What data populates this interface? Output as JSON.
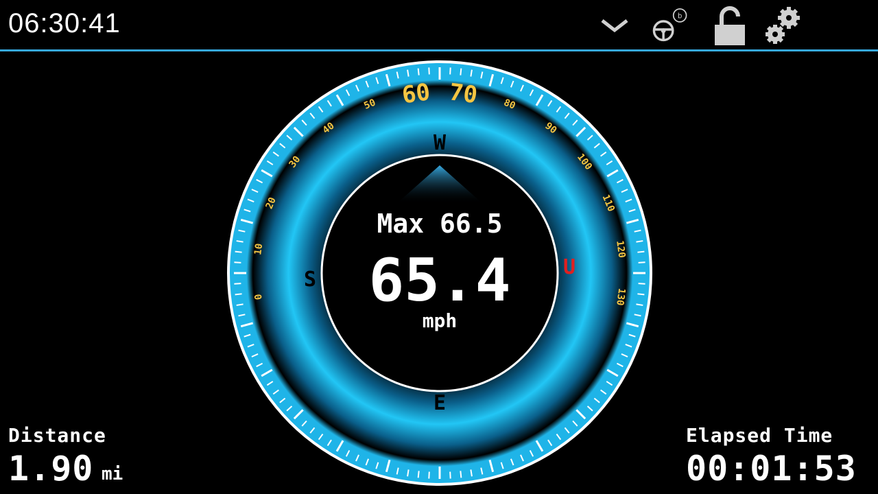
{
  "status_bar": {
    "time": "06:30:41"
  },
  "toolbar": {
    "icons": [
      "chevron-down-icon",
      "steering-wheel-icon",
      "lock-icon",
      "settings-gears-icon"
    ]
  },
  "gauge": {
    "max_label": "Max 66.5",
    "current_speed": "65.4",
    "speed_unit": "mph",
    "highlight_labels": [
      "60",
      "70"
    ],
    "scale_labels": [
      "0",
      "10",
      "20",
      "30",
      "40",
      "50",
      "80",
      "90",
      "100",
      "110",
      "120",
      "130"
    ],
    "compass": {
      "north_marker": "W",
      "south_marker": "E",
      "west_marker": "S",
      "east_marker": "U"
    },
    "colors": {
      "ring": "#1fb4e8",
      "highlight": "#f5c542",
      "compass_red": "#e02020",
      "pointer": "#36a9e1"
    }
  },
  "distance": {
    "label": "Distance",
    "value": "1.90",
    "unit": "mi"
  },
  "elapsed": {
    "label": "Elapsed Time",
    "value": "00:01:53"
  }
}
